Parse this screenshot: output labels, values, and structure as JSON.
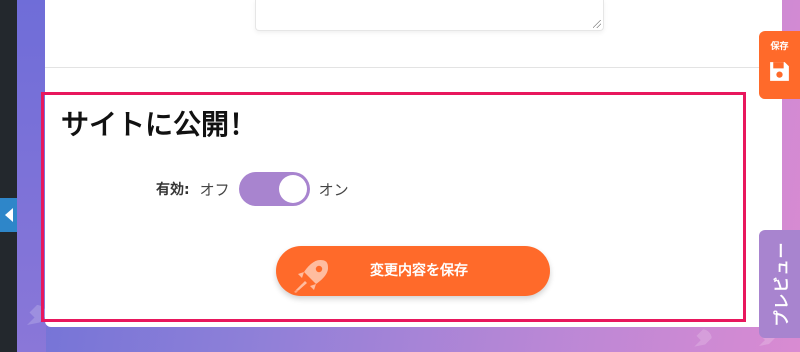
{
  "section": {
    "title": "サイトに公開！"
  },
  "toggle": {
    "label": "有効:",
    "off_text": "オフ",
    "on_text": "オン",
    "state": "on"
  },
  "actions": {
    "save_changes_label": "変更内容を保存"
  },
  "floating": {
    "save_label": "保存",
    "preview_label": "プレビュー"
  },
  "colors": {
    "accent_orange": "#ff6a2a",
    "toggle_purple": "#a884cf",
    "highlight_frame": "#e8175d"
  },
  "icons": {
    "save_button_icon": "rocket-icon",
    "float_save_icon": "floppy-disk-icon",
    "sidebar_toggle_icon": "caret-left-icon"
  }
}
